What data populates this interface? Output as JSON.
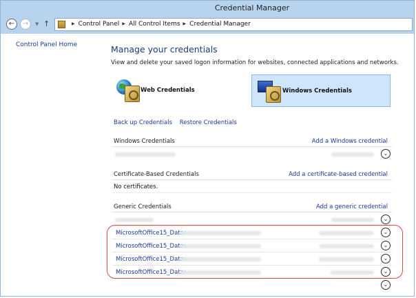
{
  "window": {
    "title": "Credential Manager"
  },
  "address": {
    "crumbs": [
      "Control Panel",
      "All Control Items",
      "Credential Manager"
    ]
  },
  "sidebar": {
    "home": "Control Panel Home"
  },
  "main": {
    "heading": "Manage your credentials",
    "description": "View and delete your saved logon information for websites, connected applications and networks.",
    "tiles": {
      "web": "Web Credentials",
      "windows": "Windows Credentials"
    },
    "links": {
      "backup": "Back up Credentials",
      "restore": "Restore Credentials"
    },
    "windows_section": {
      "title": "Windows Credentials",
      "action": "Add a Windows credential"
    },
    "cert_section": {
      "title": "Certificate-Based Credentials",
      "action": "Add a certificate-based credential",
      "empty": "No certificates."
    },
    "generic_section": {
      "title": "Generic Credentials",
      "action": "Add a generic credential",
      "items": [
        "MicrosoftOffice15_Data:",
        "MicrosoftOffice15_Data:",
        "MicrosoftOffice15_Data:",
        "MicrosoftOffice15_Data:"
      ]
    }
  },
  "colors": {
    "accent_link": "#1b3a9e",
    "selected_tile": "#cfe5fb",
    "highlight_outline": "#d84a4a"
  }
}
